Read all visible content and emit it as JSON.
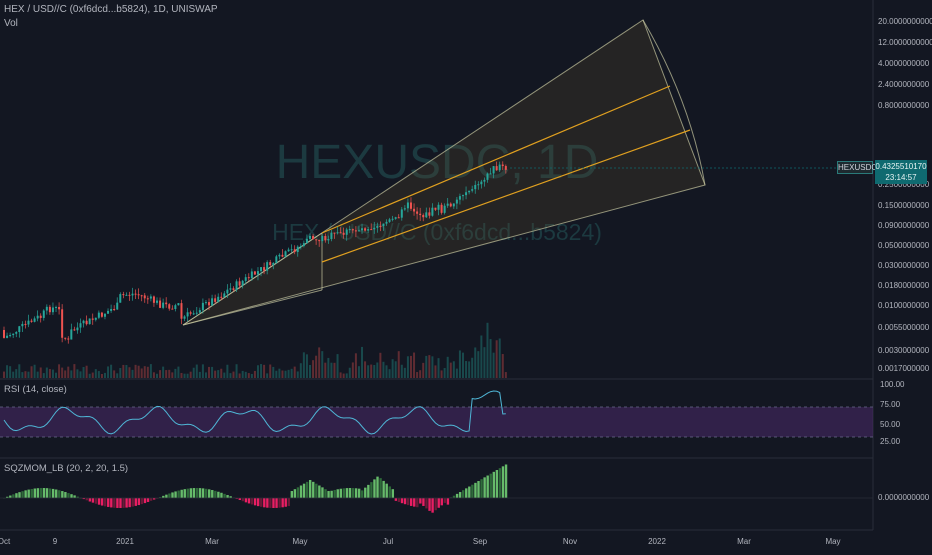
{
  "header": {
    "symbol_line": "HEX / USD//C (0xf6dcd...b5824), 1D, UNISWAP",
    "vol_label": "Vol"
  },
  "watermark": {
    "ticker": "HEXUSDC, 1D",
    "name": "HEX / USD//C (0xf6dcd...b5824)"
  },
  "price_scale_ticks": [
    "20.0000000000",
    "12.0000000000",
    "4.0000000000",
    "2.4000000000",
    "0.8000000000",
    "0.2500000000",
    "0.1500000000",
    "0.0900000000",
    "0.0500000000",
    "0.0300000000",
    "0.0180000000",
    "0.0100000000",
    "0.0055000000",
    "0.0030000000",
    "0.0017000000"
  ],
  "current_price": {
    "symbol_tag": "HEXUSDC",
    "value": "0.4325510170",
    "countdown": "23:14:57"
  },
  "rsi": {
    "label": "RSI (14, close)",
    "ticks": [
      "100.00",
      "75.00",
      "50.00",
      "25.00"
    ]
  },
  "sqzmom": {
    "label": "SQZMOM_LB (20, 2, 20, 1.5)",
    "zero_tick": "0.0000000000"
  },
  "time_axis": [
    "Oct",
    "9",
    "2021",
    "Mar",
    "May",
    "Jul",
    "Sep",
    "Nov",
    "2022",
    "Mar",
    "May"
  ],
  "colors": {
    "background": "#131722",
    "up_candle": "#26a69a",
    "down_candle": "#ef5350",
    "fan_outline": "#c8c8a0",
    "fan_fill": "#5a4a2a",
    "channel": "#e0a020",
    "rsi_line": "#4fb6d6",
    "rsi_band": "#4a2a6a",
    "sqz_up_strong": "#66bb6a",
    "sqz_up_weak": "#2e6b3a",
    "sqz_down_strong": "#e91e63",
    "sqz_down_weak": "#6b1a38",
    "badge": "#0f6a70"
  }
}
